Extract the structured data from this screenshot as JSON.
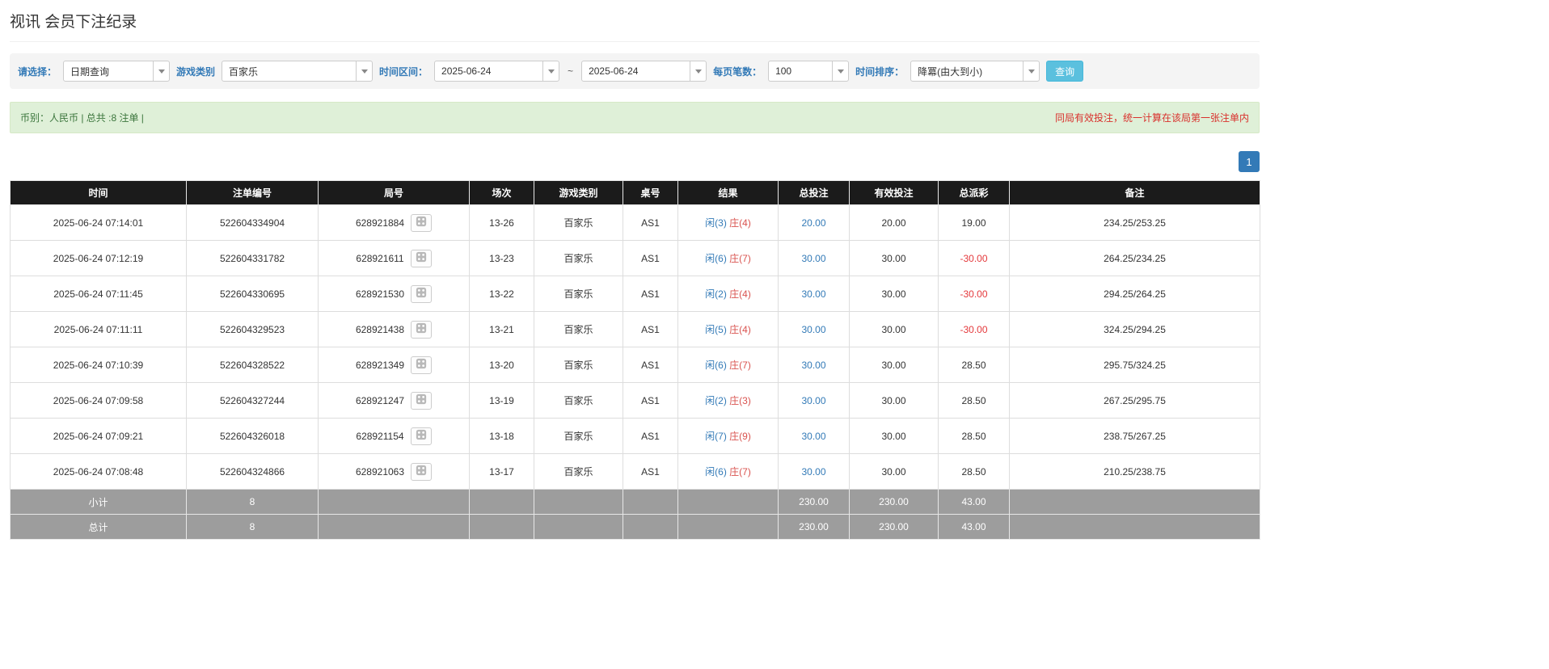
{
  "page": {
    "title": "视讯 会员下注纪录"
  },
  "filters": {
    "select_label": "请选择：",
    "select_value": "日期查询",
    "game_type_label": "游戏类别",
    "game_type_value": "百家乐",
    "time_range_label": "时间区间：",
    "date_from": "2025-06-24",
    "tilde": "~",
    "date_to": "2025-06-24",
    "page_size_label": "每页笔数：",
    "page_size_value": "100",
    "sort_label": "时间排序：",
    "sort_value": "降冪(由大到小)",
    "search_button": "查询"
  },
  "summary": {
    "left": "币别：人民币 | 总共 :8 注单 |",
    "right": "同局有效投注，统一计算在该局第一张注单内"
  },
  "pagination": {
    "current": "1"
  },
  "table": {
    "headers": [
      "时间",
      "注单编号",
      "局号",
      "场次",
      "游戏类别",
      "桌号",
      "结果",
      "总投注",
      "有效投注",
      "总派彩",
      "备注"
    ],
    "rows": [
      {
        "time": "2025-06-24 07:14:01",
        "bet_id": "522604334904",
        "round": "628921884",
        "session": "13-26",
        "game": "百家乐",
        "table_no": "AS1",
        "result_player": "闲(3)",
        "result_banker": "庄(4)",
        "total_bet": "20.00",
        "valid_bet": "20.00",
        "payout": "19.00",
        "note": "234.25/253.25"
      },
      {
        "time": "2025-06-24 07:12:19",
        "bet_id": "522604331782",
        "round": "628921611",
        "session": "13-23",
        "game": "百家乐",
        "table_no": "AS1",
        "result_player": "闲(6)",
        "result_banker": "庄(7)",
        "total_bet": "30.00",
        "valid_bet": "30.00",
        "payout": "-30.00",
        "note": "264.25/234.25"
      },
      {
        "time": "2025-06-24 07:11:45",
        "bet_id": "522604330695",
        "round": "628921530",
        "session": "13-22",
        "game": "百家乐",
        "table_no": "AS1",
        "result_player": "闲(2)",
        "result_banker": "庄(4)",
        "total_bet": "30.00",
        "valid_bet": "30.00",
        "payout": "-30.00",
        "note": "294.25/264.25"
      },
      {
        "time": "2025-06-24 07:11:11",
        "bet_id": "522604329523",
        "round": "628921438",
        "session": "13-21",
        "game": "百家乐",
        "table_no": "AS1",
        "result_player": "闲(5)",
        "result_banker": "庄(4)",
        "total_bet": "30.00",
        "valid_bet": "30.00",
        "payout": "-30.00",
        "note": "324.25/294.25"
      },
      {
        "time": "2025-06-24 07:10:39",
        "bet_id": "522604328522",
        "round": "628921349",
        "session": "13-20",
        "game": "百家乐",
        "table_no": "AS1",
        "result_player": "闲(6)",
        "result_banker": "庄(7)",
        "total_bet": "30.00",
        "valid_bet": "30.00",
        "payout": "28.50",
        "note": "295.75/324.25"
      },
      {
        "time": "2025-06-24 07:09:58",
        "bet_id": "522604327244",
        "round": "628921247",
        "session": "13-19",
        "game": "百家乐",
        "table_no": "AS1",
        "result_player": "闲(2)",
        "result_banker": "庄(3)",
        "total_bet": "30.00",
        "valid_bet": "30.00",
        "payout": "28.50",
        "note": "267.25/295.75"
      },
      {
        "time": "2025-06-24 07:09:21",
        "bet_id": "522604326018",
        "round": "628921154",
        "session": "13-18",
        "game": "百家乐",
        "table_no": "AS1",
        "result_player": "闲(7)",
        "result_banker": "庄(9)",
        "total_bet": "30.00",
        "valid_bet": "30.00",
        "payout": "28.50",
        "note": "238.75/267.25"
      },
      {
        "time": "2025-06-24 07:08:48",
        "bet_id": "522604324866",
        "round": "628921063",
        "session": "13-17",
        "game": "百家乐",
        "table_no": "AS1",
        "result_player": "闲(6)",
        "result_banker": "庄(7)",
        "total_bet": "30.00",
        "valid_bet": "30.00",
        "payout": "28.50",
        "note": "210.25/238.75"
      }
    ],
    "subtotal": {
      "label": "小计",
      "count": "8",
      "total_bet": "230.00",
      "valid_bet": "230.00",
      "payout": "43.00"
    },
    "total": {
      "label": "总计",
      "count": "8",
      "total_bet": "230.00",
      "valid_bet": "230.00",
      "payout": "43.00"
    }
  }
}
